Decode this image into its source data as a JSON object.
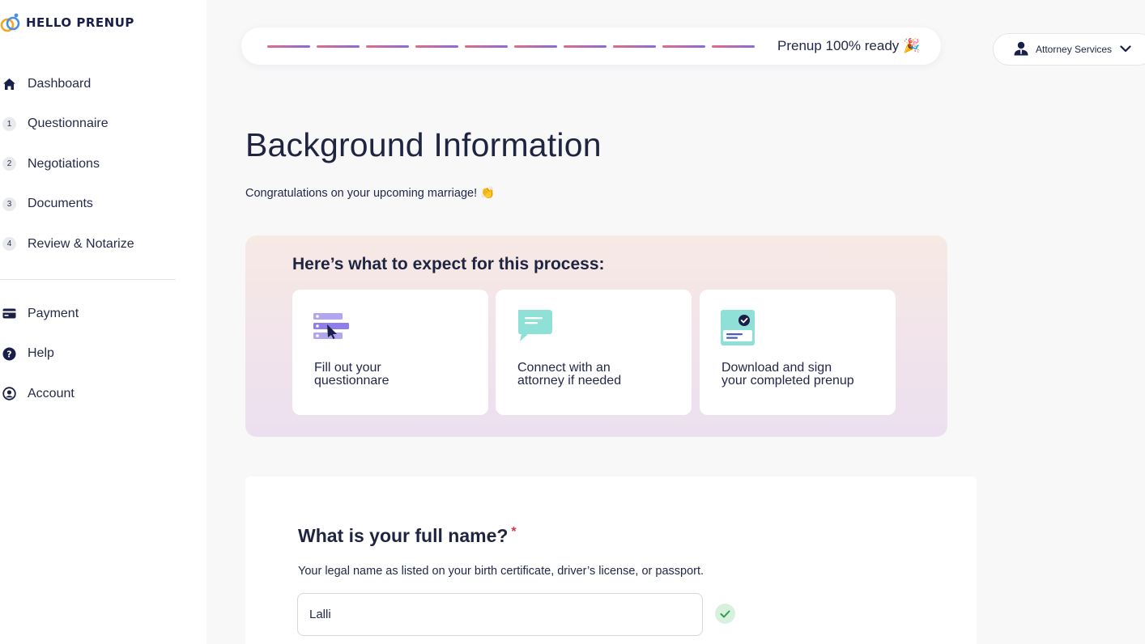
{
  "brand": {
    "name": "HELLO PRENUP",
    "logo_icon": "rings-icon"
  },
  "sidebar": {
    "items": [
      {
        "label": "Dashboard",
        "icon": "home-icon"
      },
      {
        "label": "Questionnaire",
        "step": "1"
      },
      {
        "label": "Negotiations",
        "step": "2"
      },
      {
        "label": "Documents",
        "step": "3"
      },
      {
        "label": "Review & Notarize",
        "step": "4"
      }
    ],
    "secondary": [
      {
        "label": "Payment",
        "icon": "credit-card-icon"
      },
      {
        "label": "Help",
        "icon": "help-icon"
      },
      {
        "label": "Account",
        "icon": "account-icon"
      }
    ]
  },
  "progress": {
    "segments": 10,
    "completed_fraction": 1.0,
    "label": "Prenup 100% ready 🎉"
  },
  "attorney": {
    "label": "Attorney Services",
    "icon": "attorney-icon"
  },
  "main": {
    "title": "Background Information",
    "subtitle": "Congratulations on your upcoming marriage! 👏"
  },
  "expect": {
    "title": "Here’s what to expect for this process:",
    "cards": [
      {
        "text": "Fill out your\nquestionnare",
        "icon": "questionnaire-icon"
      },
      {
        "text": "Connect with an\nattorney if needed",
        "icon": "chat-icon"
      },
      {
        "text": "Download and sign\nyour completed prenup",
        "icon": "signed-document-icon"
      }
    ]
  },
  "question": {
    "title": "What is your full name?",
    "required_mark": "*",
    "help": "Your legal name as listed on your birth certificate, driver’s license, or passport.",
    "value": "Lalli"
  },
  "colors": {
    "accent_gradient_start": "#e06b8a",
    "accent_gradient_end": "#8a6ad8",
    "success": "#2f9e55",
    "text": "#1f2440"
  }
}
